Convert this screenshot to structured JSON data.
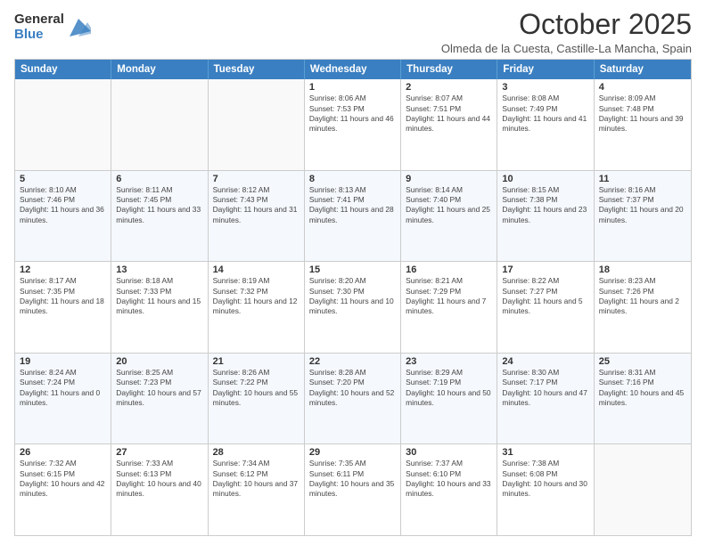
{
  "logo": {
    "general": "General",
    "blue": "Blue"
  },
  "title": "October 2025",
  "location": "Olmeda de la Cuesta, Castille-La Mancha, Spain",
  "header_days": [
    "Sunday",
    "Monday",
    "Tuesday",
    "Wednesday",
    "Thursday",
    "Friday",
    "Saturday"
  ],
  "rows": [
    [
      {
        "day": "",
        "text": ""
      },
      {
        "day": "",
        "text": ""
      },
      {
        "day": "",
        "text": ""
      },
      {
        "day": "1",
        "text": "Sunrise: 8:06 AM\nSunset: 7:53 PM\nDaylight: 11 hours and 46 minutes."
      },
      {
        "day": "2",
        "text": "Sunrise: 8:07 AM\nSunset: 7:51 PM\nDaylight: 11 hours and 44 minutes."
      },
      {
        "day": "3",
        "text": "Sunrise: 8:08 AM\nSunset: 7:49 PM\nDaylight: 11 hours and 41 minutes."
      },
      {
        "day": "4",
        "text": "Sunrise: 8:09 AM\nSunset: 7:48 PM\nDaylight: 11 hours and 39 minutes."
      }
    ],
    [
      {
        "day": "5",
        "text": "Sunrise: 8:10 AM\nSunset: 7:46 PM\nDaylight: 11 hours and 36 minutes."
      },
      {
        "day": "6",
        "text": "Sunrise: 8:11 AM\nSunset: 7:45 PM\nDaylight: 11 hours and 33 minutes."
      },
      {
        "day": "7",
        "text": "Sunrise: 8:12 AM\nSunset: 7:43 PM\nDaylight: 11 hours and 31 minutes."
      },
      {
        "day": "8",
        "text": "Sunrise: 8:13 AM\nSunset: 7:41 PM\nDaylight: 11 hours and 28 minutes."
      },
      {
        "day": "9",
        "text": "Sunrise: 8:14 AM\nSunset: 7:40 PM\nDaylight: 11 hours and 25 minutes."
      },
      {
        "day": "10",
        "text": "Sunrise: 8:15 AM\nSunset: 7:38 PM\nDaylight: 11 hours and 23 minutes."
      },
      {
        "day": "11",
        "text": "Sunrise: 8:16 AM\nSunset: 7:37 PM\nDaylight: 11 hours and 20 minutes."
      }
    ],
    [
      {
        "day": "12",
        "text": "Sunrise: 8:17 AM\nSunset: 7:35 PM\nDaylight: 11 hours and 18 minutes."
      },
      {
        "day": "13",
        "text": "Sunrise: 8:18 AM\nSunset: 7:33 PM\nDaylight: 11 hours and 15 minutes."
      },
      {
        "day": "14",
        "text": "Sunrise: 8:19 AM\nSunset: 7:32 PM\nDaylight: 11 hours and 12 minutes."
      },
      {
        "day": "15",
        "text": "Sunrise: 8:20 AM\nSunset: 7:30 PM\nDaylight: 11 hours and 10 minutes."
      },
      {
        "day": "16",
        "text": "Sunrise: 8:21 AM\nSunset: 7:29 PM\nDaylight: 11 hours and 7 minutes."
      },
      {
        "day": "17",
        "text": "Sunrise: 8:22 AM\nSunset: 7:27 PM\nDaylight: 11 hours and 5 minutes."
      },
      {
        "day": "18",
        "text": "Sunrise: 8:23 AM\nSunset: 7:26 PM\nDaylight: 11 hours and 2 minutes."
      }
    ],
    [
      {
        "day": "19",
        "text": "Sunrise: 8:24 AM\nSunset: 7:24 PM\nDaylight: 11 hours and 0 minutes."
      },
      {
        "day": "20",
        "text": "Sunrise: 8:25 AM\nSunset: 7:23 PM\nDaylight: 10 hours and 57 minutes."
      },
      {
        "day": "21",
        "text": "Sunrise: 8:26 AM\nSunset: 7:22 PM\nDaylight: 10 hours and 55 minutes."
      },
      {
        "day": "22",
        "text": "Sunrise: 8:28 AM\nSunset: 7:20 PM\nDaylight: 10 hours and 52 minutes."
      },
      {
        "day": "23",
        "text": "Sunrise: 8:29 AM\nSunset: 7:19 PM\nDaylight: 10 hours and 50 minutes."
      },
      {
        "day": "24",
        "text": "Sunrise: 8:30 AM\nSunset: 7:17 PM\nDaylight: 10 hours and 47 minutes."
      },
      {
        "day": "25",
        "text": "Sunrise: 8:31 AM\nSunset: 7:16 PM\nDaylight: 10 hours and 45 minutes."
      }
    ],
    [
      {
        "day": "26",
        "text": "Sunrise: 7:32 AM\nSunset: 6:15 PM\nDaylight: 10 hours and 42 minutes."
      },
      {
        "day": "27",
        "text": "Sunrise: 7:33 AM\nSunset: 6:13 PM\nDaylight: 10 hours and 40 minutes."
      },
      {
        "day": "28",
        "text": "Sunrise: 7:34 AM\nSunset: 6:12 PM\nDaylight: 10 hours and 37 minutes."
      },
      {
        "day": "29",
        "text": "Sunrise: 7:35 AM\nSunset: 6:11 PM\nDaylight: 10 hours and 35 minutes."
      },
      {
        "day": "30",
        "text": "Sunrise: 7:37 AM\nSunset: 6:10 PM\nDaylight: 10 hours and 33 minutes."
      },
      {
        "day": "31",
        "text": "Sunrise: 7:38 AM\nSunset: 6:08 PM\nDaylight: 10 hours and 30 minutes."
      },
      {
        "day": "",
        "text": ""
      }
    ]
  ]
}
